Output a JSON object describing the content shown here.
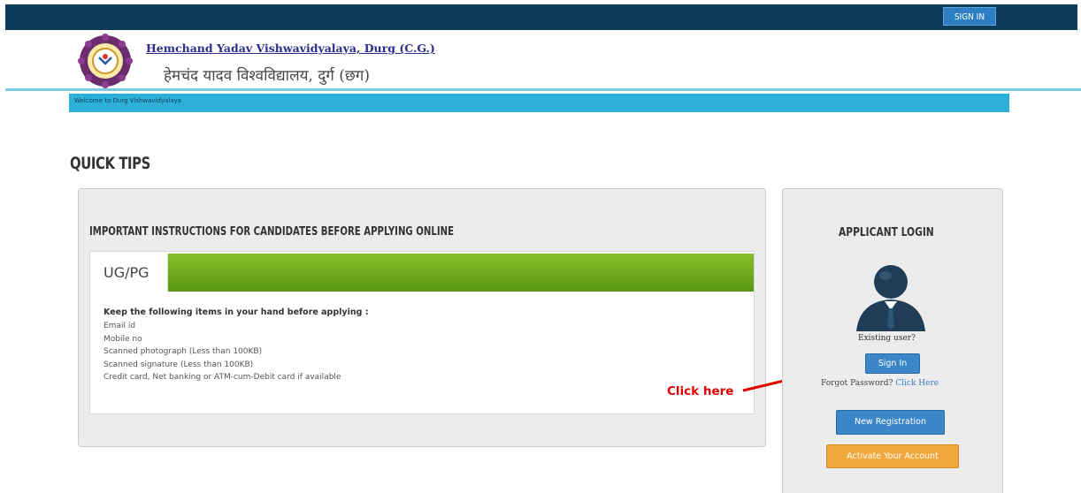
{
  "header": {
    "signin_label": "SIGN IN",
    "university_en": "Hemchand Yadav Vishwavidyalaya, Durg (C.G.)",
    "university_hi": "हेमचंद यादव विश्वविद्यालय, दुर्ग (छग)",
    "welcome_text": "Welcome to Durg Vishwavidyalaya"
  },
  "quick_tips": {
    "title": "QUICK TIPS",
    "instructions_title": "IMPORTANT INSTRUCTIONS FOR CANDIDATES BEFORE APPLYING ONLINE",
    "tab_label": "UG/PG",
    "heading": "Keep the following items in your hand before applying :",
    "items": [
      "Email id",
      "Mobile no",
      "Scanned photograph (Less than 100KB)",
      "Scanned signature (Less than 100KB)",
      "Credit card, Net banking or ATM-cum-Debit card if available"
    ]
  },
  "annotation": {
    "click_here": "Click here"
  },
  "login": {
    "title": "APPLICANT LOGIN",
    "existing_user": "Existing user?",
    "sign_in_label": "Sign In",
    "forgot_text": "Forgot Password?",
    "click_here_link": "Click Here",
    "new_registration_label": "New Registration",
    "activate_label": "Activate Your Account"
  },
  "colors": {
    "topbar": "#0e3a5a",
    "welcome_bar": "#2cb0d8",
    "green_bar": "#6aab1a",
    "primary_button": "#3a86c8",
    "warning_button": "#f0a83c",
    "annotation_red": "#e10000"
  }
}
